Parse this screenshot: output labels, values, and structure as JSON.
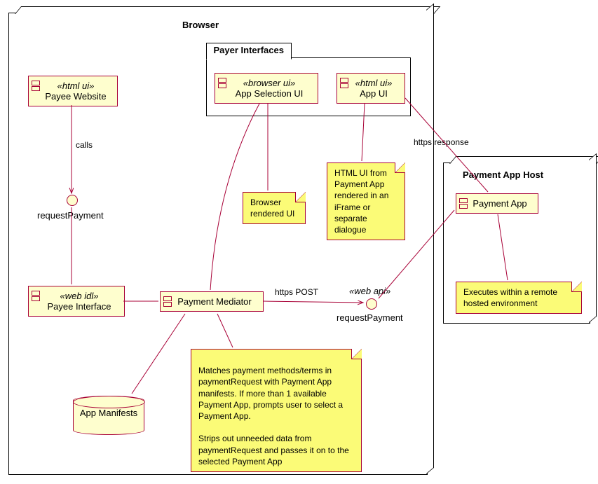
{
  "nodes": {
    "browser_title": "Browser",
    "payment_app_host_title": "Payment App Host"
  },
  "packages": {
    "payer_interfaces": "Payer Interfaces"
  },
  "components": {
    "payee_website": {
      "stereotype": "«html ui»",
      "name": "Payee Website"
    },
    "app_selection_ui": {
      "stereotype": "«browser ui»",
      "name": "App Selection UI"
    },
    "app_ui": {
      "stereotype": "«html ui»",
      "name": "App UI"
    },
    "payee_interface": {
      "stereotype": "«web idl»",
      "name": "Payee Interface"
    },
    "payment_mediator": {
      "name": "Payment Mediator"
    },
    "payment_app": {
      "name": "Payment App"
    }
  },
  "interfaces": {
    "request_payment_1": "requestPayment",
    "request_payment_2": {
      "stereotype": "«web api»",
      "name": "requestPayment"
    }
  },
  "database": {
    "app_manifests": "App Manifests"
  },
  "notes": {
    "browser_rendered_ui": "Browser rendered UI",
    "html_ui_note": "HTML UI from Payment App rendered in an iFrame or separate dialogue",
    "mediator_note": "Matches payment methods/terms in paymentRequest with Payment App manifests. If more than 1 available Payment App, prompts user to select a Payment App.\n\nStrips out unneeded data from paymentRequest and passes it on to the selected Payment App",
    "payment_app_note": "Executes within a remote hosted environment"
  },
  "edges": {
    "calls": "calls",
    "https_post": "https POST",
    "https_response": "https response"
  }
}
